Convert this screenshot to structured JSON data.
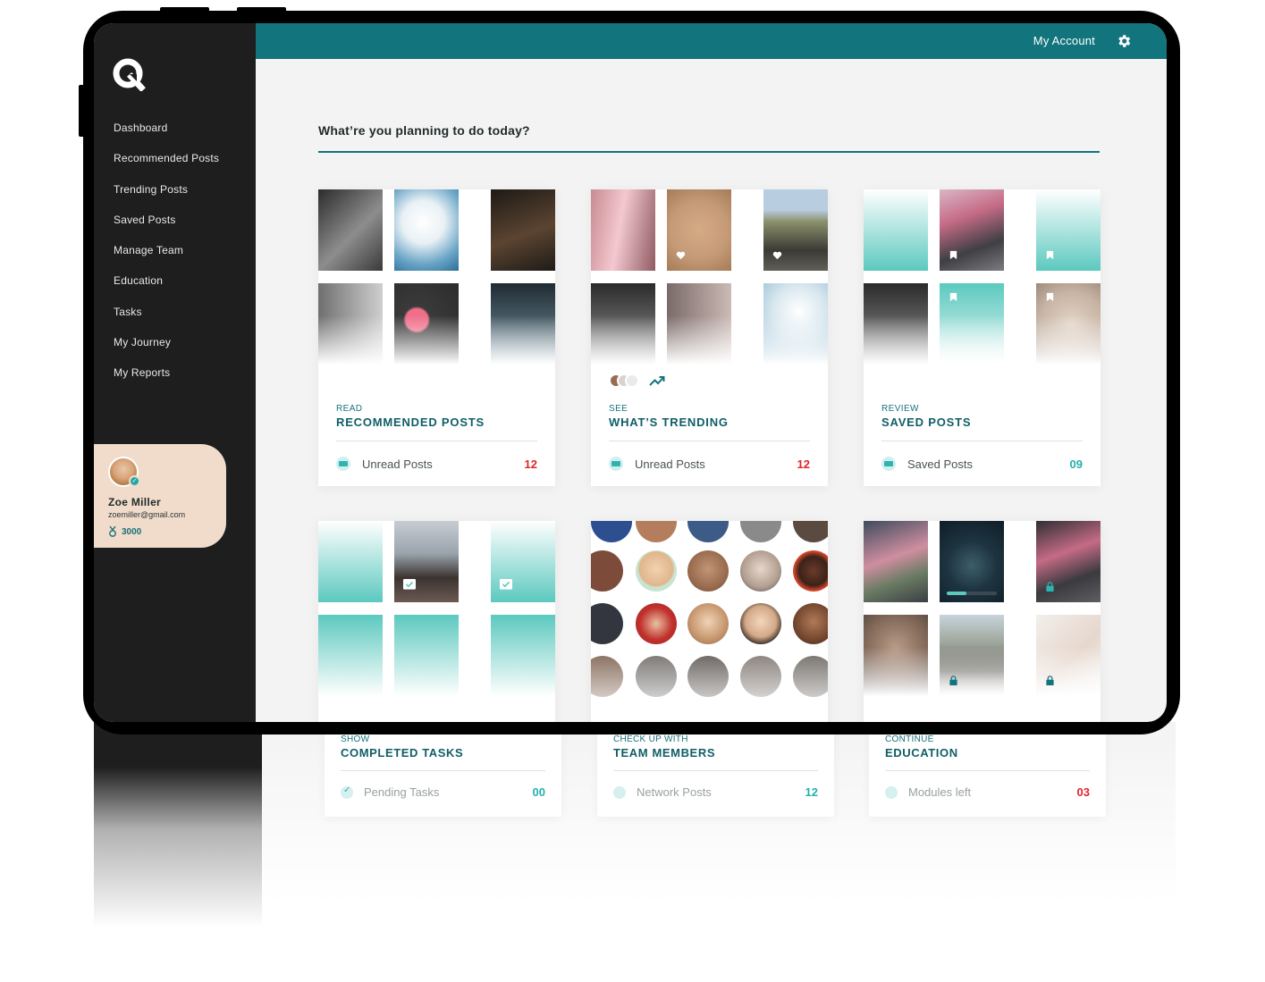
{
  "sidebar": {
    "logo_icon": "q-logo-icon",
    "items": [
      {
        "label": "Dashboard"
      },
      {
        "label": "Recommended Posts"
      },
      {
        "label": "Trending Posts"
      },
      {
        "label": "Saved Posts"
      },
      {
        "label": "Manage Team"
      },
      {
        "label": "Education"
      },
      {
        "label": "Tasks"
      },
      {
        "label": "My Journey"
      },
      {
        "label": "My Reports"
      }
    ],
    "profile": {
      "name": "Zoe Miller",
      "email": "zoemiller@gmail.com",
      "points": "3000"
    }
  },
  "header": {
    "account_label": "My Account",
    "settings_icon": "gear-icon"
  },
  "main": {
    "heading": "What’re you planning to do today?",
    "cards": [
      {
        "eyebrow": "READ",
        "title": "RECOMMENDED POSTS",
        "stat_label": "Unread Posts",
        "stat_value": "12"
      },
      {
        "eyebrow": "SEE",
        "title": "WHAT’S TRENDING",
        "stat_label": "Unread Posts",
        "stat_value": "12"
      },
      {
        "eyebrow": "REVIEW",
        "title": "SAVED POSTS",
        "stat_label": "Saved Posts",
        "stat_value": "09"
      }
    ],
    "cards_bottom": [
      {
        "eyebrow": "SHOW",
        "title": "COMPLETED TASKS",
        "stat_label": "Pending Tasks",
        "stat_value": "00"
      },
      {
        "eyebrow": "CHECK UP WITH",
        "title": "TEAM MEMBERS",
        "stat_label": "Network Posts",
        "stat_value": "12"
      },
      {
        "eyebrow": "CONTINUE",
        "title": "EDUCATION",
        "stat_label": "Modules left",
        "stat_value": "03"
      }
    ]
  },
  "colors": {
    "accent": "#12747c",
    "sidebar_bg": "#1e1e1e",
    "profile_bg": "#f1dccb",
    "alert_red": "#e0252b",
    "stat_teal": "#24b0ad"
  }
}
